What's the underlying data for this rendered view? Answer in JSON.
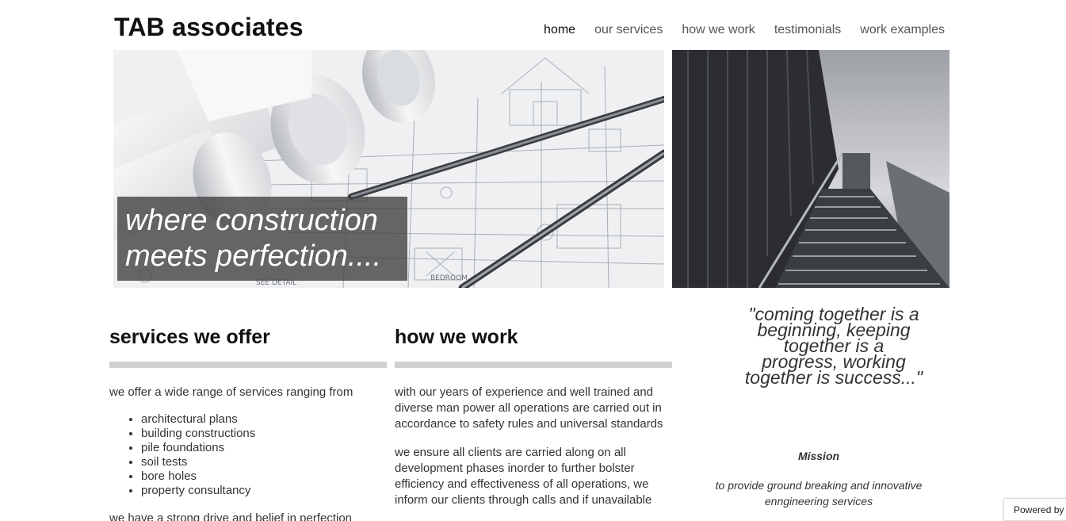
{
  "header": {
    "brand": "TAB associates",
    "nav": [
      {
        "label": "home",
        "active": true
      },
      {
        "label": "our services",
        "active": false
      },
      {
        "label": "how we work",
        "active": false
      },
      {
        "label": "testimonials",
        "active": false
      },
      {
        "label": "work examples",
        "active": false
      }
    ]
  },
  "hero": {
    "caption_line1": "where construction",
    "caption_line2": "meets perfection....",
    "blueprint_labels": {
      "bedroom": "BEDROOM",
      "see_detail": "SEE DETAIL"
    }
  },
  "services": {
    "heading": "services we offer",
    "intro": "we offer a wide range of services ranging from",
    "items": [
      "architectural plans",
      "building constructions",
      "pile foundations",
      "soil tests",
      "bore holes",
      "property consultancy"
    ],
    "more": "we have a strong drive and belief in perfection"
  },
  "work": {
    "heading": "how we work",
    "p1": "with our years of experience and well trained and diverse man power all operations are carried out in accordance to safety rules and universal standards",
    "p2": "we ensure all clients are carried along on all development phases inorder to further bolster efficiency and effectiveness of all operations, we inform our clients through calls and if unavailable"
  },
  "aside": {
    "quote": "\"coming together is a beginning, keeping together is a progress, working together is success...\"",
    "mission_title": "Mission",
    "mission_text": "to provide ground breaking and innovative enngineering services"
  },
  "footer": {
    "powered_by": "Powered by"
  }
}
